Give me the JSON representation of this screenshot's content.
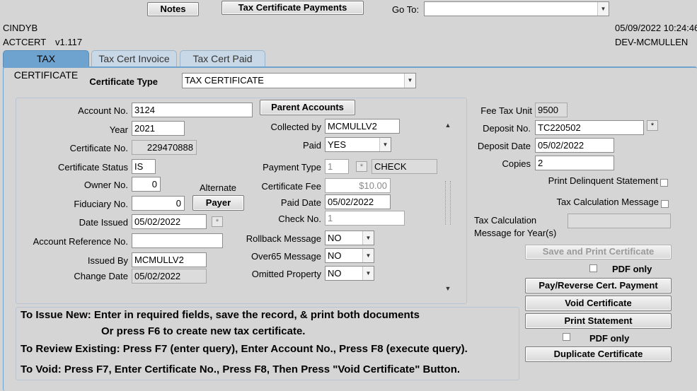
{
  "toolbar": {
    "notes_label": "Notes",
    "payments_label": "Tax Certificate Payments",
    "goto_label": "Go To:",
    "goto_value": ""
  },
  "header": {
    "user": "CINDYB",
    "form_name": "ACTCERT",
    "version": "v1.117",
    "datetime": "05/09/2022 10:24:46",
    "environment": "DEV-MCMULLEN"
  },
  "tabs": [
    {
      "label": "TAX CERTIFICATE"
    },
    {
      "label": "Tax Cert Invoice"
    },
    {
      "label": "Tax Cert Paid"
    }
  ],
  "cert_type": {
    "label": "Certificate Type",
    "value": "TAX CERTIFICATE"
  },
  "left": {
    "account_no": {
      "label": "Account No.",
      "value": "3124"
    },
    "year": {
      "label": "Year",
      "value": "2021"
    },
    "certificate_no": {
      "label": "Certificate No.",
      "value": "229470888"
    },
    "certificate_status": {
      "label": "Certificate Status",
      "value": "IS"
    },
    "owner_no": {
      "label": "Owner No.",
      "value": "0"
    },
    "fiduciary_no": {
      "label": "Fiduciary No.",
      "value": "0"
    },
    "date_issued": {
      "label": "Date Issued",
      "value": "05/02/2022"
    },
    "account_reference_no": {
      "label": "Account Reference No.",
      "value": ""
    },
    "issued_by": {
      "label": "Issued By",
      "value": "MCMULLV2"
    },
    "change_date": {
      "label": "Change Date",
      "value": "05/02/2022"
    },
    "parent_accounts_label": "Parent Accounts",
    "alternate_label": "Alternate",
    "payer_label": "Payer"
  },
  "middle": {
    "collected_by": {
      "label": "Collected by",
      "value": "MCMULLV2"
    },
    "paid": {
      "label": "Paid",
      "value": "YES"
    },
    "payment_type": {
      "label": "Payment Type",
      "code": "1",
      "value": "CHECK"
    },
    "certificate_fee": {
      "label": "Certificate Fee",
      "value": "$10.00"
    },
    "paid_date": {
      "label": "Paid Date",
      "value": "05/02/2022"
    },
    "check_no": {
      "label": "Check No.",
      "value": "1"
    },
    "rollback_message": {
      "label": "Rollback Message",
      "value": "NO"
    },
    "over65_message": {
      "label": "Over65 Message",
      "value": "NO"
    },
    "omitted_property": {
      "label": "Omitted Property",
      "value": "NO"
    }
  },
  "right": {
    "fee_tax_unit": {
      "label": "Fee Tax Unit",
      "value": "9500"
    },
    "deposit_no": {
      "label": "Deposit No.",
      "value": "TC220502"
    },
    "deposit_date": {
      "label": "Deposit Date",
      "value": "05/02/2022"
    },
    "copies": {
      "label": "Copies",
      "value": "2"
    },
    "print_delinquent_label": "Print Delinquent Statement",
    "tax_calc_message_label": "Tax Calculation Message",
    "tax_calc_years_label_1": "Tax Calculation",
    "tax_calc_years_label_2": "Message for Year(s)",
    "tax_calc_years_value": "",
    "save_print_label": "Save and Print Certificate",
    "pdf_only_label_1": "PDF only",
    "pay_reverse_label": "Pay/Reverse Cert. Payment",
    "void_label": "Void Certificate",
    "print_statement_label": "Print Statement",
    "pdf_only_label_2": "PDF only",
    "duplicate_label": "Duplicate Certificate"
  },
  "instructions": {
    "line1": "To Issue New: Enter in required fields, save the record, & print both documents",
    "line2": "Or press F6 to create  new tax certificate.",
    "line3": "To Review Existing: Press F7 (enter query), Enter Account No., Press F8 (execute query).",
    "line4": "To Void:  Press F7, Enter Certificate No., Press F8, Then Press \"Void Certificate\" Button."
  },
  "colors": {
    "background": "#d5d5d5",
    "active_tab": "#6fa3cf",
    "inactive_tab": "#c9d8e6"
  }
}
